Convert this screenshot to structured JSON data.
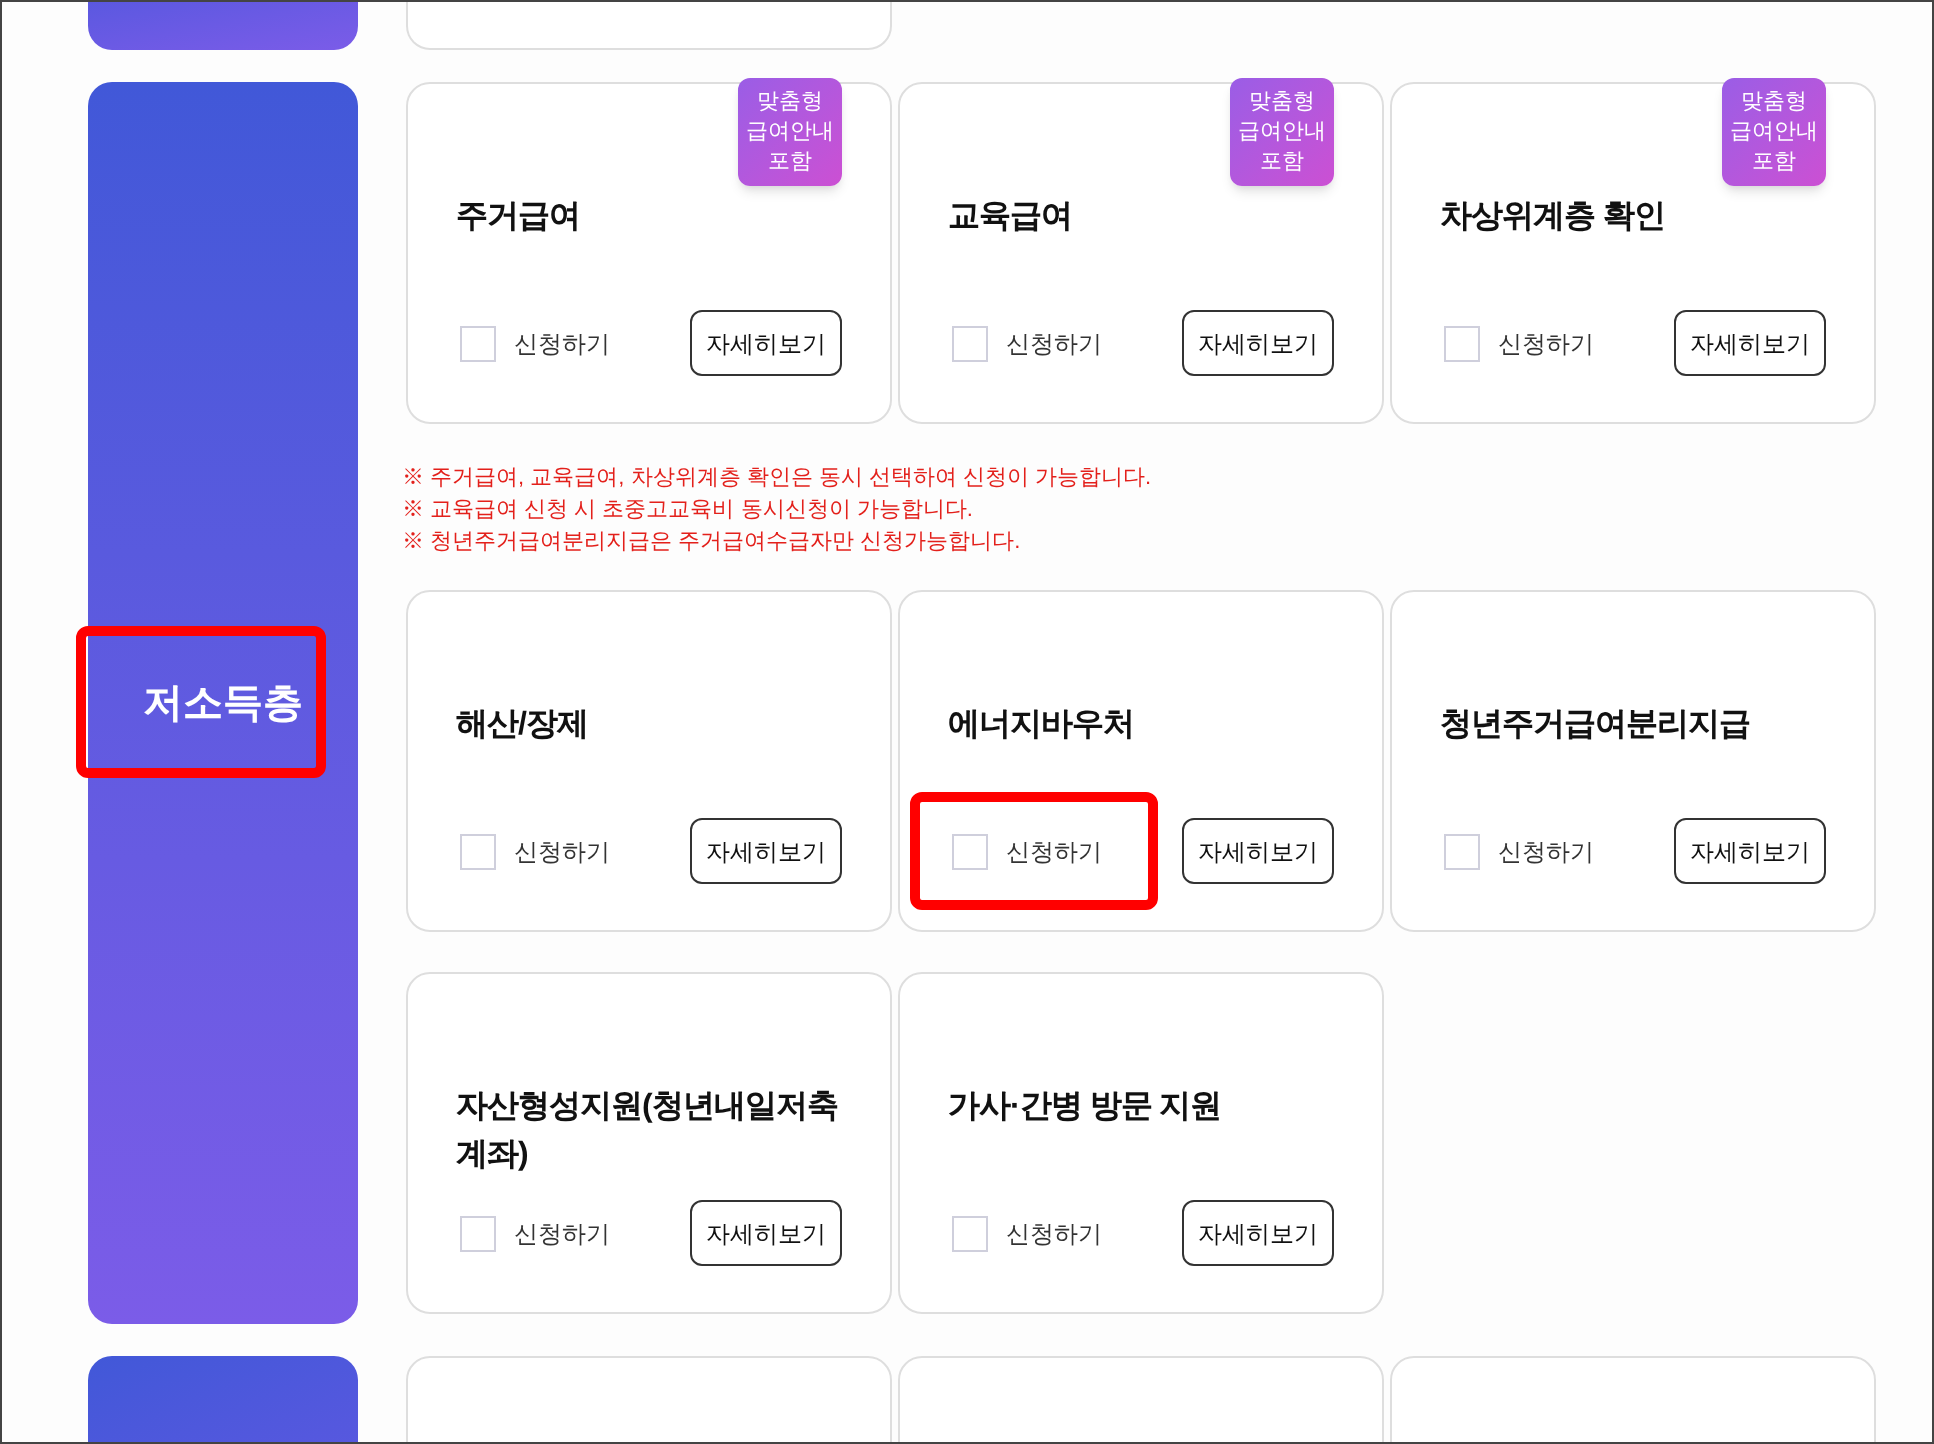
{
  "category": {
    "label": "저소득층",
    "highlighted": true
  },
  "card_groups": [
    {
      "cards": [
        {
          "title": "주거급여",
          "badge_lines": [
            "맞춤형",
            "급여안내",
            "포함"
          ],
          "checkbox": {
            "label": "신청하기",
            "checked": false,
            "highlighted": false
          },
          "button": "자세히보기"
        },
        {
          "title": "교육급여",
          "badge_lines": [
            "맞춤형",
            "급여안내",
            "포함"
          ],
          "checkbox": {
            "label": "신청하기",
            "checked": false,
            "highlighted": false
          },
          "button": "자세히보기"
        },
        {
          "title": "차상위계층 확인",
          "badge_lines": [
            "맞춤형",
            "급여안내",
            "포함"
          ],
          "checkbox": {
            "label": "신청하기",
            "checked": false,
            "highlighted": false
          },
          "button": "자세히보기"
        }
      ],
      "notes": [
        "※ 주거급여, 교육급여, 차상위계층 확인은 동시 선택하여 신청이 가능합니다.",
        "※ 교육급여 신청 시 초중고교육비 동시신청이 가능합니다.",
        "※ 청년주거급여분리지급은 주거급여수급자만 신청가능합니다."
      ]
    },
    {
      "cards": [
        {
          "title": "해산/장제",
          "checkbox": {
            "label": "신청하기",
            "checked": false,
            "highlighted": false
          },
          "button": "자세히보기"
        },
        {
          "title": "에너지바우처",
          "checkbox": {
            "label": "신청하기",
            "checked": false,
            "highlighted": true
          },
          "button": "자세히보기"
        },
        {
          "title": "청년주거급여분리지급",
          "checkbox": {
            "label": "신청하기",
            "checked": false,
            "highlighted": false
          },
          "button": "자세히보기"
        },
        {
          "title": "자산형성지원(청년내일저축 계좌)",
          "checkbox": {
            "label": "신청하기",
            "checked": false,
            "highlighted": false
          },
          "button": "자세히보기"
        },
        {
          "title": "가사·간병 방문 지원",
          "checkbox": {
            "label": "신청하기",
            "checked": false,
            "highlighted": false
          },
          "button": "자세히보기"
        }
      ]
    }
  ]
}
